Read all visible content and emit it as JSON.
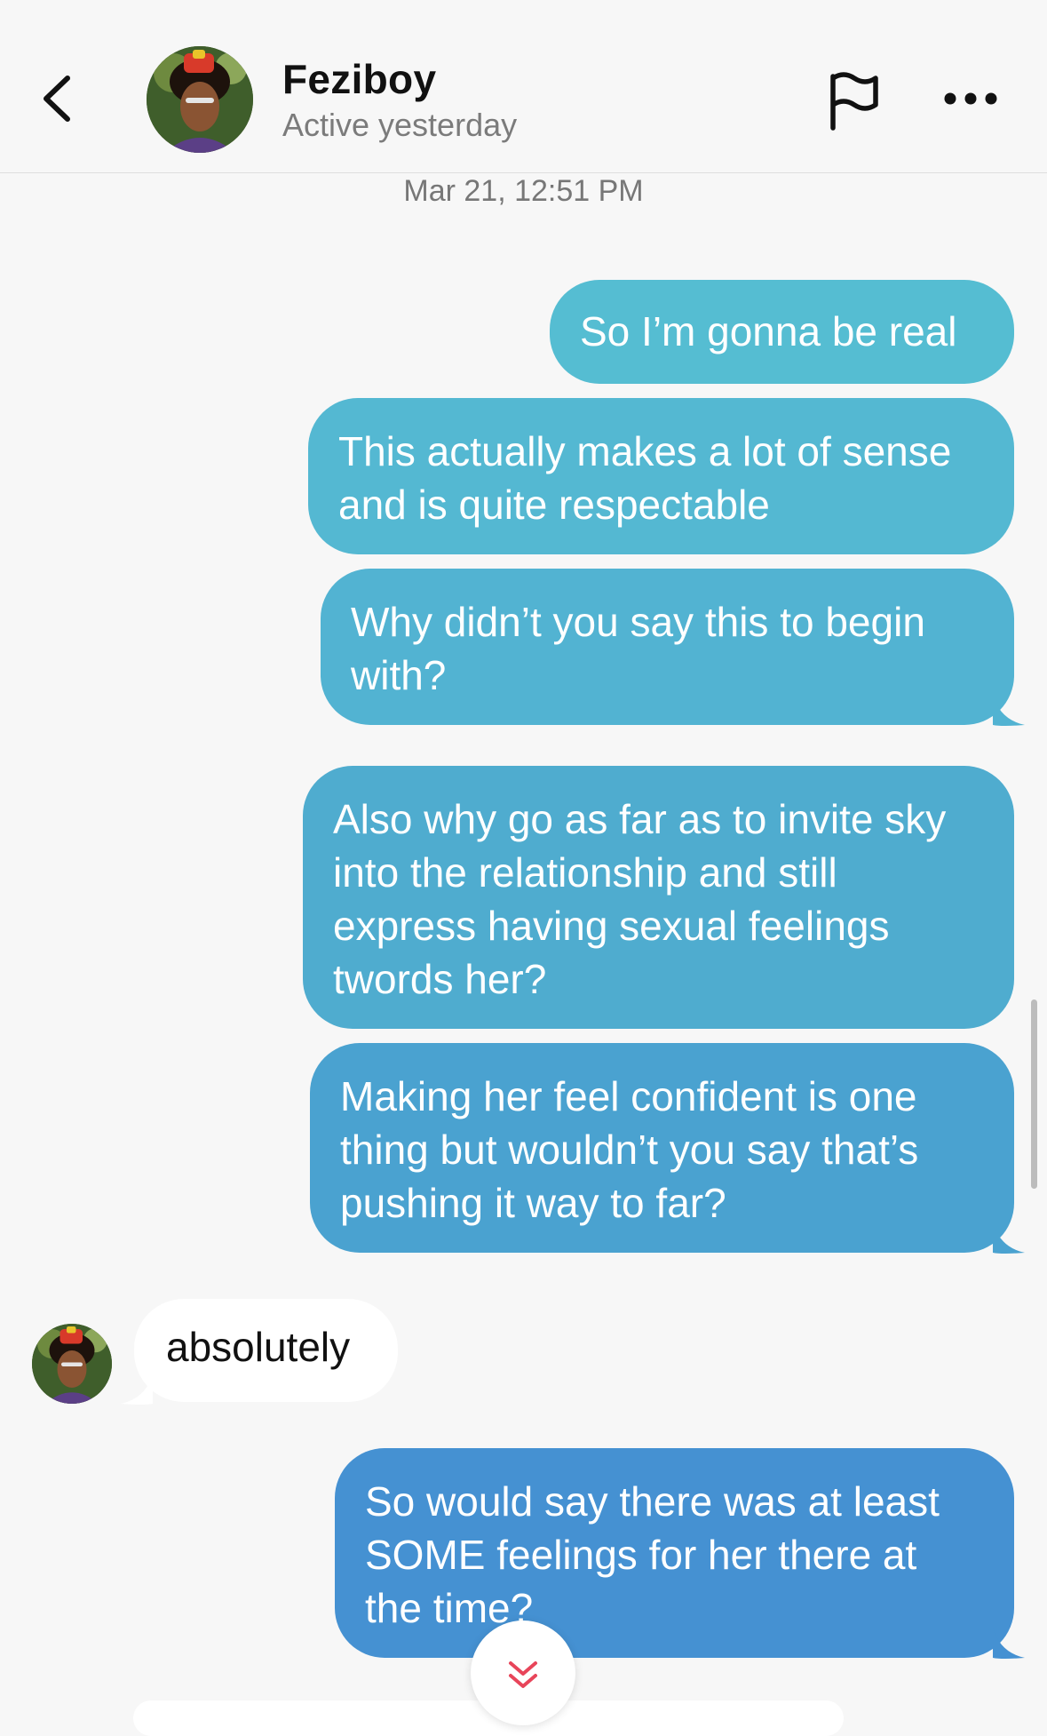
{
  "header": {
    "contact_name": "Feziboy",
    "status": "Active yesterday",
    "icons": {
      "back": "chevron-left-icon",
      "report": "flag-icon",
      "more": "more-horizontal-icon"
    }
  },
  "conversation": {
    "timestamp": "Mar 21, 12:51 PM",
    "messages": [
      {
        "sender": "me",
        "lines": [
          "So I’m gonna be real"
        ]
      },
      {
        "sender": "me",
        "lines": [
          "This actually makes a lot of sense",
          "and is quite respectable"
        ]
      },
      {
        "sender": "me",
        "lines": [
          "Why didn’t you say this to begin",
          "with?"
        ]
      },
      {
        "sender": "me",
        "lines": [
          "Also why go as far as to invite sky",
          "into the relationship and still",
          "express having sexual feelings",
          "twords her?"
        ]
      },
      {
        "sender": "me",
        "lines": [
          "Making her feel confident is one",
          "thing but wouldn’t you say that’s",
          "pushing it way to far?"
        ]
      },
      {
        "sender": "them",
        "lines": [
          "absolutely"
        ]
      },
      {
        "sender": "me",
        "lines": [
          "So would say there was at least",
          "SOME feelings for her there at",
          "the time?"
        ]
      }
    ]
  },
  "controls": {
    "scroll_to_bottom_icon": "double-chevron-down-icon"
  },
  "colors": {
    "bubble_top": "#55bdd2",
    "bubble_mid": "#4faad0",
    "bubble_bottom": "#4591d2",
    "accent_red": "#e8455a"
  }
}
